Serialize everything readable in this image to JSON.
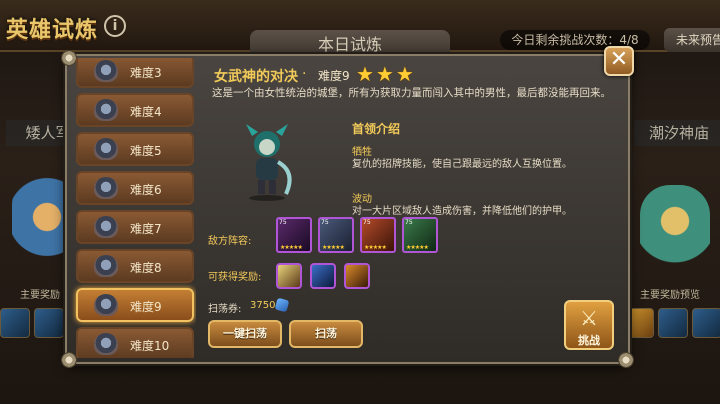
{
  "header": {
    "title": "英雄试炼",
    "today_tab": "本日试炼",
    "remaining_challenges": "今日剩余挑战次数：4/8",
    "future_preview": "未来预告"
  },
  "background": {
    "left_stage": "矮人军",
    "right_stage": "潮汐神庙",
    "left_reward_label": "主要奖励",
    "right_reward_label": "主要奖励预览"
  },
  "difficulty_list": [
    {
      "label": "难度3"
    },
    {
      "label": "难度4"
    },
    {
      "label": "难度5"
    },
    {
      "label": "难度6"
    },
    {
      "label": "难度7"
    },
    {
      "label": "难度8"
    },
    {
      "label": "难度9",
      "active": true
    },
    {
      "label": "难度10"
    }
  ],
  "stage": {
    "name": "女武神的对决",
    "separator": "·",
    "difficulty": "难度9",
    "stars": 3,
    "stars_text": "★★★",
    "description": "这是一个由女性统治的城堡，所有为获取力量而闯入其中的男性，最后都没能再回来。"
  },
  "boss": {
    "heading": "首领介绍",
    "skills": [
      {
        "name": "牺牲",
        "desc": "复仇的招牌技能，使自己跟最远的敌人互换位置。"
      },
      {
        "name": "波动",
        "desc": "对一大片区域敌人造成伤害，并降低他们的护甲。"
      }
    ]
  },
  "enemies": {
    "label": "敌方阵容:",
    "heroes": [
      {
        "level": "75",
        "stars": "★★★★★",
        "color": "#5a2a6a"
      },
      {
        "level": "75",
        "stars": "★★★★★",
        "color": "#4a5a7a"
      },
      {
        "level": "75",
        "stars": "★★★★★",
        "color": "#b44a2a"
      },
      {
        "level": "75",
        "stars": "★★★★★",
        "color": "#3a7a4a"
      }
    ]
  },
  "rewards": {
    "label": "可获得奖励:",
    "items": [
      {
        "icon": "scroll-icon",
        "color": "#e8d27a"
      },
      {
        "icon": "dagger-icon",
        "color": "#3a6ec8"
      },
      {
        "icon": "staff-icon",
        "color": "#d88a2a"
      }
    ]
  },
  "sweep_ticket": {
    "label": "扫荡券:",
    "count": "3750"
  },
  "buttons": {
    "sweep_all": "一键扫荡",
    "sweep": "扫荡",
    "challenge": "挑战",
    "close": "✕"
  }
}
